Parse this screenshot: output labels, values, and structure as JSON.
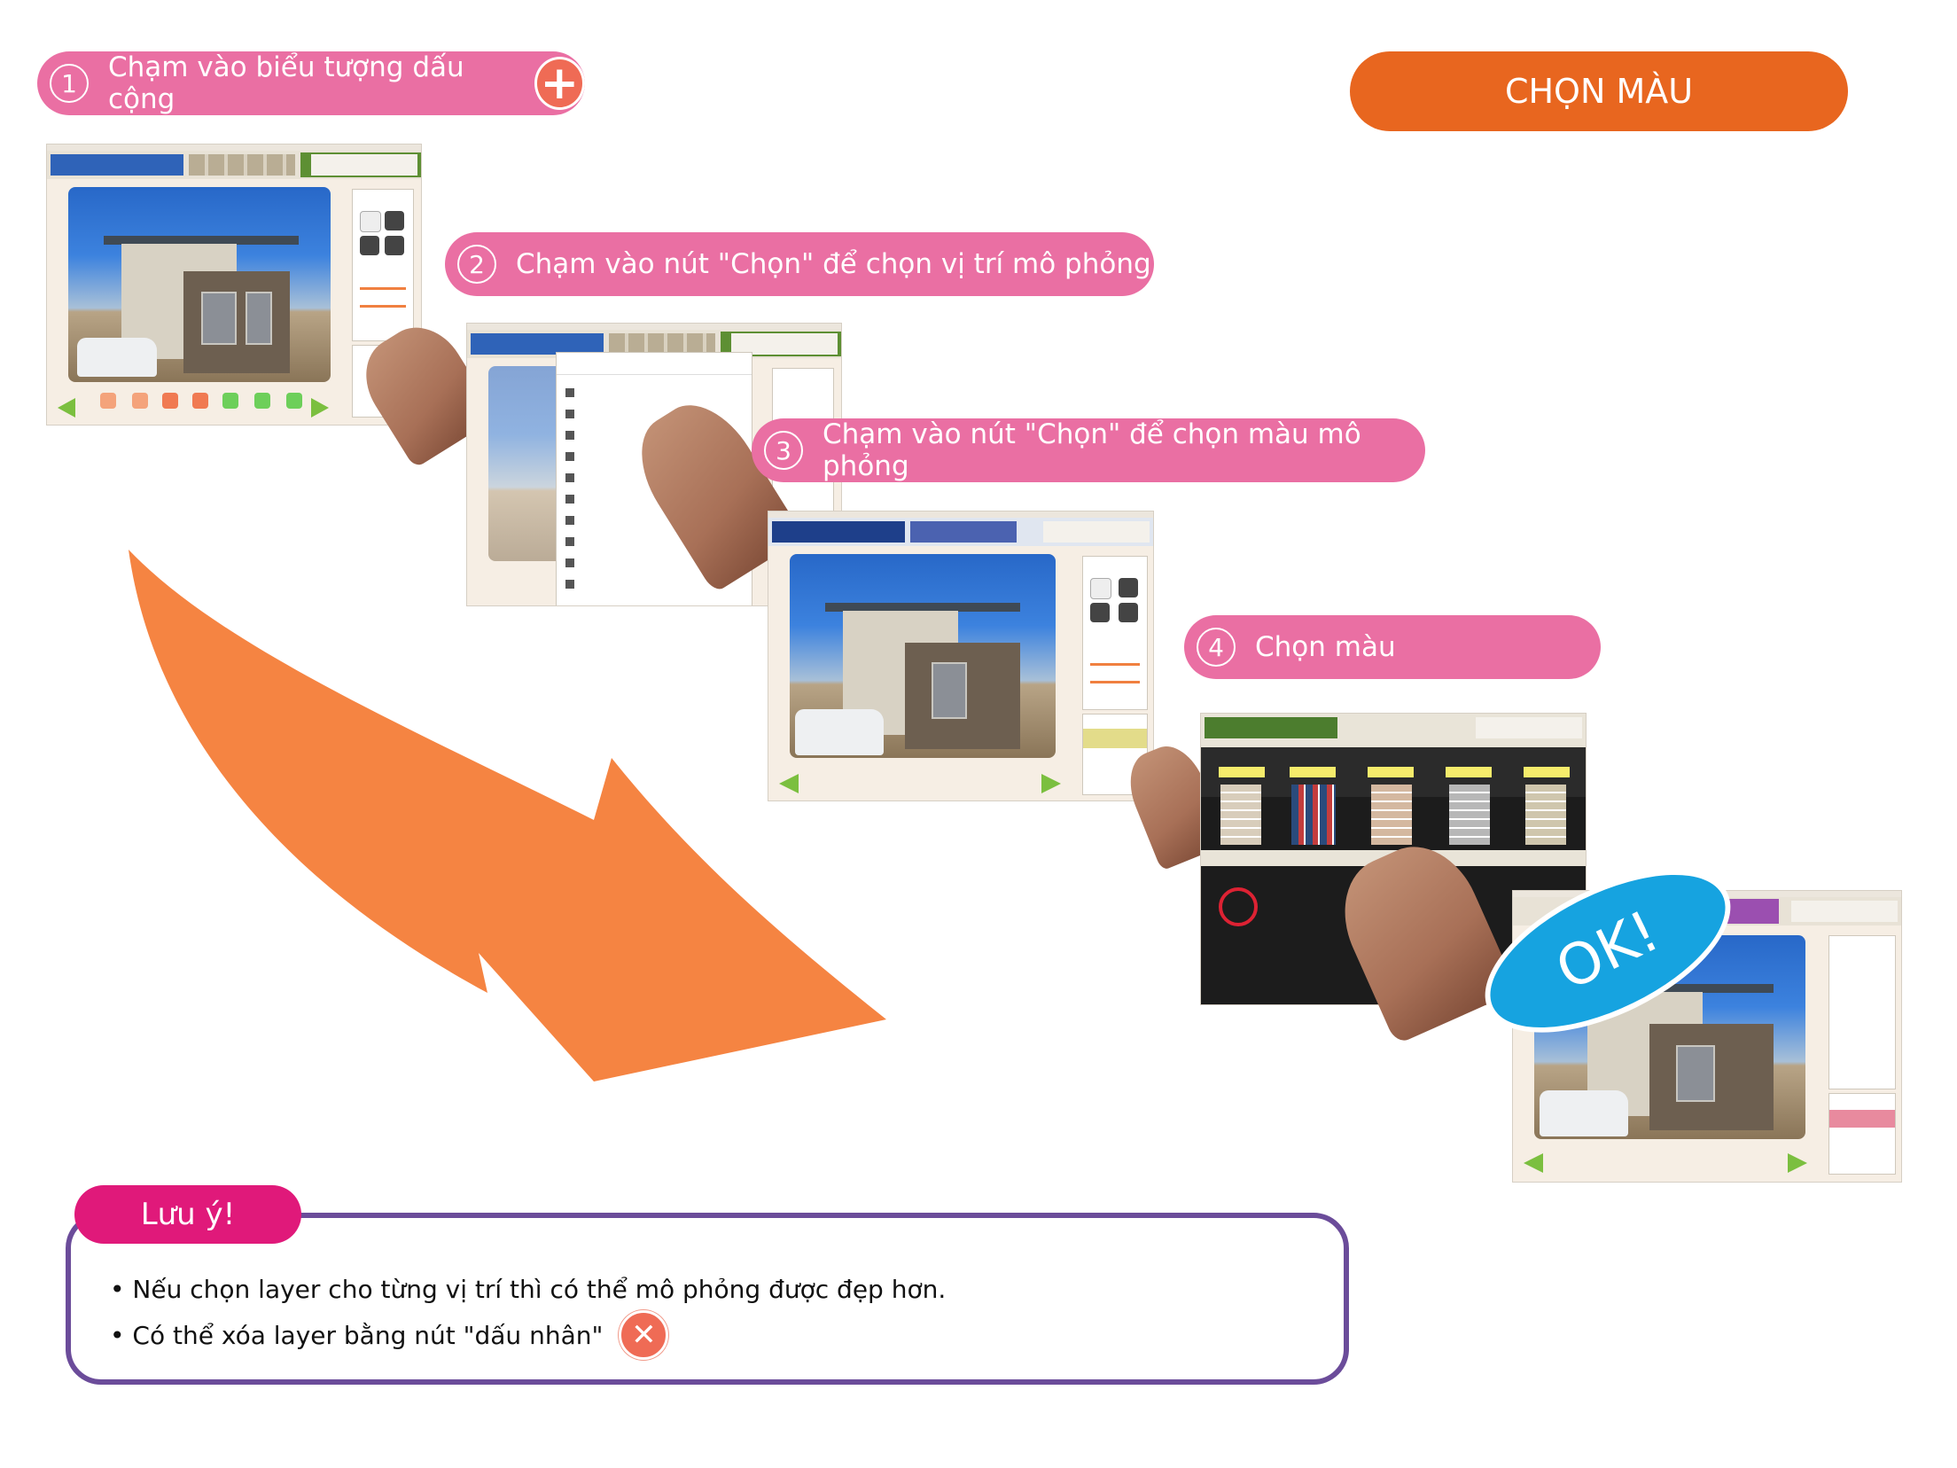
{
  "title": "CHỌN MÀU",
  "steps": [
    {
      "number": "1",
      "text": "Chạm vào biểu tượng dấu cộng"
    },
    {
      "number": "2",
      "text": "Chạm vào nút \"Chọn\" để chọn vị trí mô phỏng"
    },
    {
      "number": "3",
      "text": "Chạm vào nút \"Chọn\" để chọn màu mô phỏng"
    },
    {
      "number": "4",
      "text": "Chọn màu"
    }
  ],
  "ok_label": "OK!",
  "note": {
    "tag": "Lưu ý!",
    "lines": [
      "Nếu chọn layer cho từng vị trí thì có thể mô phỏng được đẹp hơn.",
      "Có thể xóa layer bằng nút \"dấu nhân\""
    ]
  },
  "icons": {
    "plus": "plus-circle-icon",
    "close": "close-circle-icon",
    "arrow": "curved-arrow-icon"
  },
  "colors": {
    "step_pill": "#ea6fa3",
    "title_pill": "#e8661f",
    "arrow": "#f58442",
    "note_border": "#6b4c9a",
    "note_tag": "#e0197a",
    "ok_bubble": "#16a3e0"
  }
}
